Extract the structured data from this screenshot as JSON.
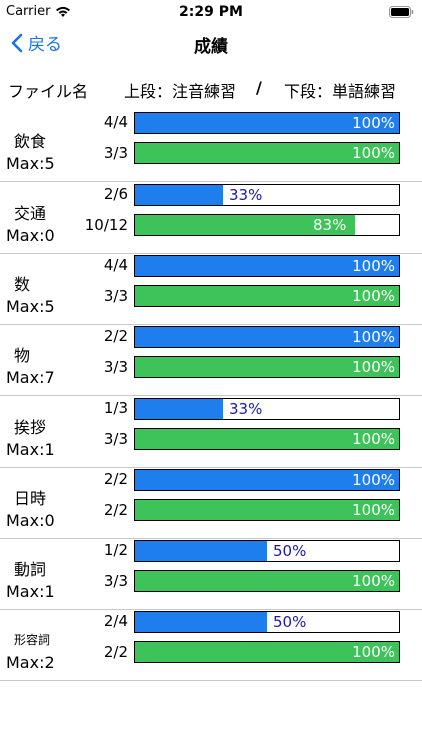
{
  "status_bar": {
    "carrier": "Carrier",
    "time": "2:29 PM"
  },
  "nav": {
    "back_label": "戻る",
    "title": "成績"
  },
  "header": {
    "file_label": "ファイル名",
    "upper_label": "上段：注音練習",
    "slash": "/",
    "lower_label": "下段：単語練習"
  },
  "colors": {
    "accent": "#1a73e8",
    "bar_blue": "#1f7eed",
    "bar_green": "#3ec35a"
  },
  "categories": [
    {
      "name": "飲食",
      "max": "Max:5",
      "top": {
        "score": "4/4",
        "ratio": 1.0,
        "pct": "100%"
      },
      "bottom": {
        "score": "3/3",
        "ratio": 1.0,
        "pct": "100%"
      }
    },
    {
      "name": "交通",
      "max": "Max:0",
      "top": {
        "score": "2/6",
        "ratio": 0.333,
        "pct": "33%"
      },
      "bottom": {
        "score": "10/12",
        "ratio": 0.833,
        "pct": "83%"
      }
    },
    {
      "name": "数",
      "max": "Max:5",
      "top": {
        "score": "4/4",
        "ratio": 1.0,
        "pct": "100%"
      },
      "bottom": {
        "score": "3/3",
        "ratio": 1.0,
        "pct": "100%"
      }
    },
    {
      "name": "物",
      "max": "Max:7",
      "top": {
        "score": "2/2",
        "ratio": 1.0,
        "pct": "100%"
      },
      "bottom": {
        "score": "3/3",
        "ratio": 1.0,
        "pct": "100%"
      }
    },
    {
      "name": "挨拶",
      "max": "Max:1",
      "top": {
        "score": "1/3",
        "ratio": 0.333,
        "pct": "33%"
      },
      "bottom": {
        "score": "3/3",
        "ratio": 1.0,
        "pct": "100%"
      }
    },
    {
      "name": "日時",
      "max": "Max:0",
      "top": {
        "score": "2/2",
        "ratio": 1.0,
        "pct": "100%"
      },
      "bottom": {
        "score": "2/2",
        "ratio": 1.0,
        "pct": "100%"
      }
    },
    {
      "name": "動詞",
      "max": "Max:1",
      "top": {
        "score": "1/2",
        "ratio": 0.5,
        "pct": "50%"
      },
      "bottom": {
        "score": "3/3",
        "ratio": 1.0,
        "pct": "100%"
      }
    },
    {
      "name": "形容詞",
      "max": "Max:2",
      "top": {
        "score": "2/4",
        "ratio": 0.5,
        "pct": "50%"
      },
      "bottom": {
        "score": "2/2",
        "ratio": 1.0,
        "pct": "100%"
      }
    }
  ]
}
